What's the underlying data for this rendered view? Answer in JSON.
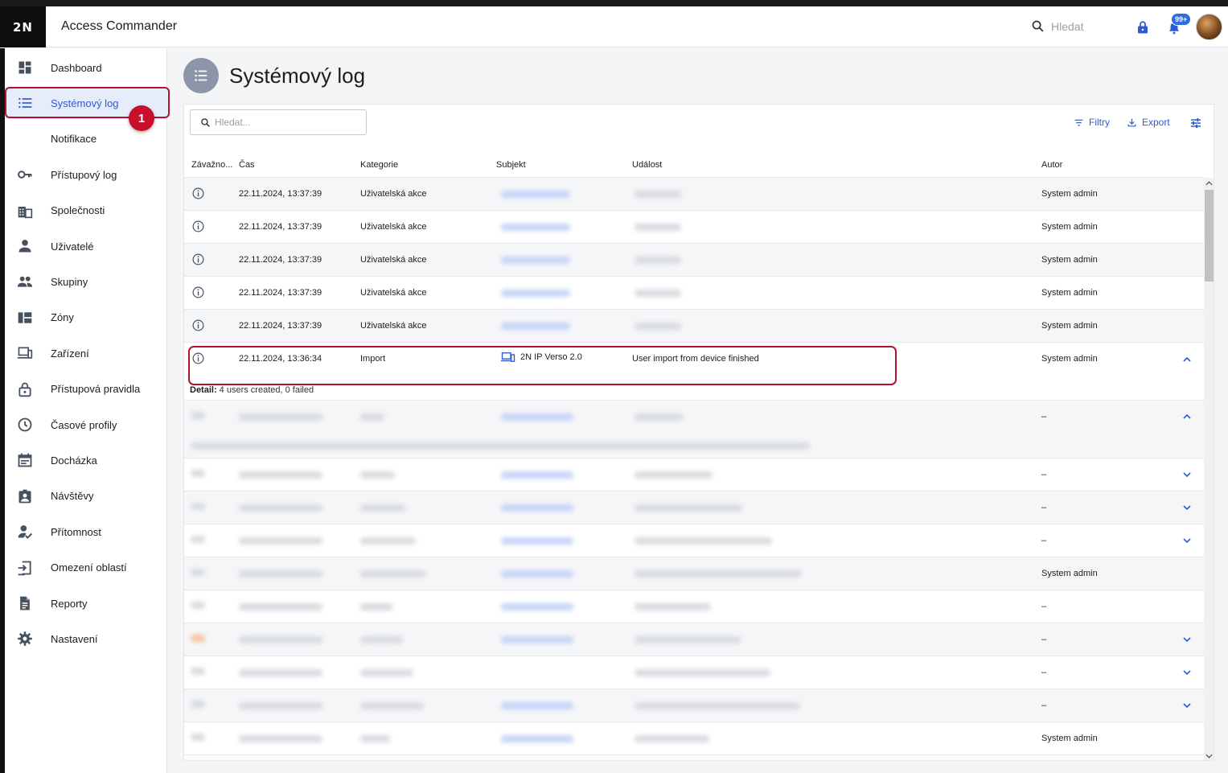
{
  "app": {
    "logo": "2N",
    "title": "Access Commander"
  },
  "topbar": {
    "search_placeholder": "Hledat",
    "notification_badge": "99+"
  },
  "sidebar": {
    "items": [
      {
        "label": "Dashboard",
        "icon": "dashboard-icon"
      },
      {
        "label": "Systémový log",
        "icon": "list-icon",
        "active": true
      },
      {
        "label": "Notifikace",
        "icon": ""
      },
      {
        "label": "Přístupový log",
        "icon": "key-icon"
      },
      {
        "label": "Společnosti",
        "icon": "building-icon"
      },
      {
        "label": "Uživatelé",
        "icon": "person-icon"
      },
      {
        "label": "Skupiny",
        "icon": "group-icon"
      },
      {
        "label": "Zóny",
        "icon": "zones-icon"
      },
      {
        "label": "Zařízení",
        "icon": "devices-icon"
      },
      {
        "label": "Přístupová pravidla",
        "icon": "lock-icon"
      },
      {
        "label": "Časové profily",
        "icon": "clock-icon"
      },
      {
        "label": "Docházka",
        "icon": "calendar-icon"
      },
      {
        "label": "Návštěvy",
        "icon": "visitor-badge-icon"
      },
      {
        "label": "Přítomnost",
        "icon": "person-check-icon"
      },
      {
        "label": "Omezení oblastí",
        "icon": "area-restriction-icon"
      },
      {
        "label": "Reporty",
        "icon": "report-icon"
      },
      {
        "label": "Nastavení",
        "icon": "gear-icon"
      }
    ],
    "callout_number": "1"
  },
  "page": {
    "title": "Systémový log"
  },
  "toolbar": {
    "search_placeholder": "Hledat...",
    "filters_label": "Filtry",
    "export_label": "Export"
  },
  "table": {
    "headers": {
      "severity": "Závažno...",
      "time": "Čas",
      "category": "Kategorie",
      "subject": "Subjekt",
      "event": "Událost",
      "author": "Autor"
    },
    "rows": [
      {
        "time": "22.11.2024, 13:37:39",
        "category": "Uživatelská akce",
        "author": "System admin"
      },
      {
        "time": "22.11.2024, 13:37:39",
        "category": "Uživatelská akce",
        "author": "System admin"
      },
      {
        "time": "22.11.2024, 13:37:39",
        "category": "Uživatelská akce",
        "author": "System admin"
      },
      {
        "time": "22.11.2024, 13:37:39",
        "category": "Uživatelská akce",
        "author": "System admin"
      },
      {
        "time": "22.11.2024, 13:37:39",
        "category": "Uživatelská akce",
        "author": "System admin"
      }
    ],
    "expanded_row": {
      "time": "22.11.2024, 13:36:34",
      "category": "Import",
      "subject": "2N IP Verso 2.0",
      "event": "User import from device finished",
      "author": "System admin",
      "detail_label": "Detail:",
      "detail_text": " 4 users created, 0 failed"
    },
    "blurred_rows": [
      {
        "author": "–"
      },
      {
        "author": "–"
      },
      {
        "author": "–"
      },
      {
        "author": "–"
      },
      {
        "author": "System admin"
      },
      {
        "author": "–"
      },
      {
        "author": "–"
      },
      {
        "author": "–"
      },
      {
        "author": "–"
      },
      {
        "author": "System admin"
      }
    ]
  },
  "colors": {
    "accent": "#2e5bd0",
    "highlight": "#b0142c",
    "active_bg": "#e7ecfb"
  }
}
